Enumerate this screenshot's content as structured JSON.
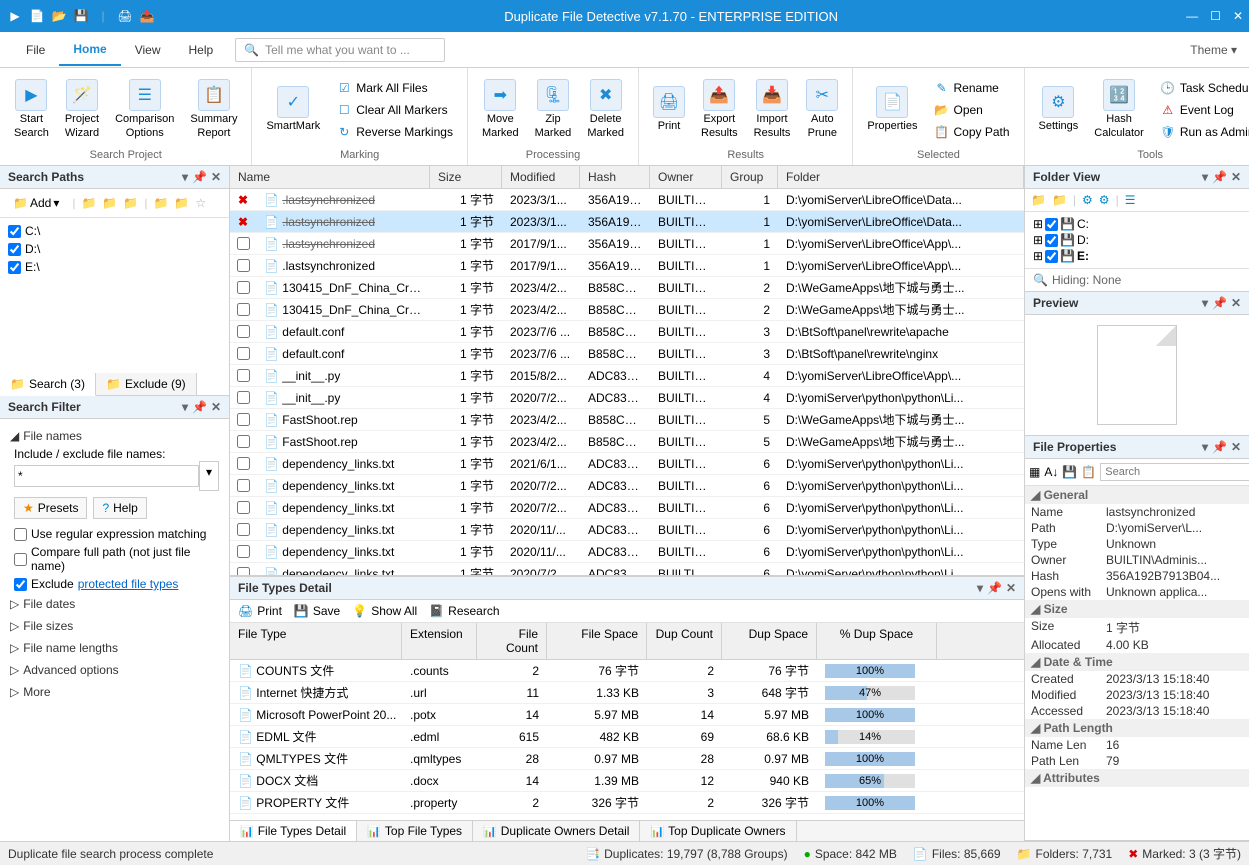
{
  "title": "Duplicate File Detective v7.1.70 - ENTERPRISE EDITION",
  "menu": {
    "file": "File",
    "home": "Home",
    "view": "View",
    "help": "Help",
    "search_placeholder": "Tell me what you want to ...",
    "theme": "Theme"
  },
  "ribbon": {
    "g1_label": "Search Project",
    "start_search": "Start\nSearch",
    "project_wizard": "Project\nWizard",
    "comparison_options": "Comparison\nOptions",
    "summary_report": "Summary\nReport",
    "g2_label": "Marking",
    "smartmark": "SmartMark",
    "mark_all": "Mark All Files",
    "clear_all": "Clear All Markers",
    "reverse": "Reverse Markings",
    "g3_label": "Processing",
    "move_marked": "Move\nMarked",
    "zip_marked": "Zip\nMarked",
    "delete_marked": "Delete\nMarked",
    "g4_label": "Results",
    "print": "Print",
    "export": "Export\nResults",
    "import": "Import\nResults",
    "auto_prune": "Auto\nPrune",
    "g5_label": "Selected",
    "properties": "Properties",
    "rename": "Rename",
    "open": "Open",
    "copy_path": "Copy Path",
    "g6_label": "Tools",
    "settings": "Settings",
    "hash_calc": "Hash\nCalculator",
    "task_sched": "Task Scheduler",
    "event_log": "Event Log",
    "run_admin": "Run as Admin"
  },
  "search_paths": {
    "title": "Search Paths",
    "add": "Add",
    "drives": [
      "C:\\",
      "D:\\",
      "E:\\"
    ]
  },
  "path_tabs": {
    "search": "Search (3)",
    "exclude": "Exclude (9)"
  },
  "filter": {
    "title": "Search Filter",
    "filenames": "File names",
    "include_label": "Include / exclude file names:",
    "include_value": "*",
    "presets": "Presets",
    "help": "Help",
    "regex": "Use regular expression matching",
    "fullpath": "Compare full path (not just file name)",
    "exclude": "Exclude ",
    "protected": "protected file types",
    "dates": "File dates",
    "sizes": "File sizes",
    "lengths": "File name lengths",
    "advanced": "Advanced options",
    "more": "More"
  },
  "grid_cols": {
    "name": "Name",
    "size": "Size",
    "modified": "Modified",
    "hash": "Hash",
    "owner": "Owner",
    "group": "Group",
    "folder": "Folder"
  },
  "rows": [
    {
      "chk": "x",
      "name": ".lastsynchronized",
      "strike": true,
      "size": "1 字节",
      "mod": "2023/3/1...",
      "hash": "356A192B...",
      "owner": "BUILTIN\\...",
      "grp": "1",
      "folder": "D:\\yomiServer\\LibreOffice\\Data..."
    },
    {
      "chk": "x",
      "name": ".lastsynchronized",
      "strike": true,
      "sel": true,
      "size": "1 字节",
      "mod": "2023/3/1...",
      "hash": "356A192B...",
      "owner": "BUILTIN\\...",
      "grp": "1",
      "folder": "D:\\yomiServer\\LibreOffice\\Data..."
    },
    {
      "chk": "",
      "name": ".lastsynchronized",
      "strike": true,
      "size": "1 字节",
      "mod": "2017/9/1...",
      "hash": "356A192B...",
      "owner": "BUILTIN\\...",
      "grp": "1",
      "folder": "D:\\yomiServer\\LibreOffice\\App\\..."
    },
    {
      "chk": "",
      "name": ".lastsynchronized",
      "size": "1 字节",
      "mod": "2017/9/1...",
      "hash": "356A192B...",
      "owner": "BUILTIN\\...",
      "grp": "1",
      "folder": "D:\\yomiServer\\LibreOffice\\App\\..."
    },
    {
      "chk": "",
      "name": "130415_DnF_China_Creator...",
      "size": "1 字节",
      "mod": "2023/4/2...",
      "hash": "B858CB2...",
      "owner": "BUILTIN\\...",
      "grp": "2",
      "folder": "D:\\WeGameApps\\地下城与勇士..."
    },
    {
      "chk": "",
      "name": "130415_DnF_China_Creator...",
      "size": "1 字节",
      "mod": "2023/4/2...",
      "hash": "B858CB2...",
      "owner": "BUILTIN\\...",
      "grp": "2",
      "folder": "D:\\WeGameApps\\地下城与勇士..."
    },
    {
      "chk": "",
      "name": "default.conf",
      "size": "1 字节",
      "mod": "2023/7/6 ...",
      "hash": "B858CB2...",
      "owner": "BUILTIN\\...",
      "grp": "3",
      "folder": "D:\\BtSoft\\panel\\rewrite\\apache"
    },
    {
      "chk": "",
      "name": "default.conf",
      "size": "1 字节",
      "mod": "2023/7/6 ...",
      "hash": "B858CB2...",
      "owner": "BUILTIN\\...",
      "grp": "3",
      "folder": "D:\\BtSoft\\panel\\rewrite\\nginx"
    },
    {
      "chk": "",
      "name": "__init__.py",
      "size": "1 字节",
      "mod": "2015/8/2...",
      "hash": "ADC83B1...",
      "owner": "BUILTIN\\...",
      "grp": "4",
      "folder": "D:\\yomiServer\\LibreOffice\\App\\..."
    },
    {
      "chk": "",
      "name": "__init__.py",
      "size": "1 字节",
      "mod": "2020/7/2...",
      "hash": "ADC83B1...",
      "owner": "BUILTIN\\...",
      "grp": "4",
      "folder": "D:\\yomiServer\\python\\python\\Li..."
    },
    {
      "chk": "",
      "name": "FastShoot.rep",
      "size": "1 字节",
      "mod": "2023/4/2...",
      "hash": "B858CB2...",
      "owner": "BUILTIN\\...",
      "grp": "5",
      "folder": "D:\\WeGameApps\\地下城与勇士..."
    },
    {
      "chk": "",
      "name": "FastShoot.rep",
      "size": "1 字节",
      "mod": "2023/4/2...",
      "hash": "B858CB2...",
      "owner": "BUILTIN\\...",
      "grp": "5",
      "folder": "D:\\WeGameApps\\地下城与勇士..."
    },
    {
      "chk": "",
      "name": "dependency_links.txt",
      "size": "1 字节",
      "mod": "2021/6/1...",
      "hash": "ADC83B1...",
      "owner": "BUILTIN\\...",
      "grp": "6",
      "folder": "D:\\yomiServer\\python\\python\\Li..."
    },
    {
      "chk": "",
      "name": "dependency_links.txt",
      "size": "1 字节",
      "mod": "2020/7/2...",
      "hash": "ADC83B1...",
      "owner": "BUILTIN\\...",
      "grp": "6",
      "folder": "D:\\yomiServer\\python\\python\\Li..."
    },
    {
      "chk": "",
      "name": "dependency_links.txt",
      "size": "1 字节",
      "mod": "2020/7/2...",
      "hash": "ADC83B1...",
      "owner": "BUILTIN\\...",
      "grp": "6",
      "folder": "D:\\yomiServer\\python\\python\\Li..."
    },
    {
      "chk": "",
      "name": "dependency_links.txt",
      "size": "1 字节",
      "mod": "2020/11/...",
      "hash": "ADC83B1...",
      "owner": "BUILTIN\\...",
      "grp": "6",
      "folder": "D:\\yomiServer\\python\\python\\Li..."
    },
    {
      "chk": "",
      "name": "dependency_links.txt",
      "size": "1 字节",
      "mod": "2020/11/...",
      "hash": "ADC83B1...",
      "owner": "BUILTIN\\...",
      "grp": "6",
      "folder": "D:\\yomiServer\\python\\python\\Li..."
    },
    {
      "chk": "",
      "name": "dependency_links.txt",
      "size": "1 字节",
      "mod": "2020/7/2...",
      "hash": "ADC83B1...",
      "owner": "BUILTIN\\...",
      "grp": "6",
      "folder": "D:\\yomiServer\\python\\python\\Li..."
    }
  ],
  "detail": {
    "title": "File Types Detail",
    "print": "Print",
    "save": "Save",
    "show_all": "Show All",
    "research": "Research",
    "cols": {
      "type": "File Type",
      "ext": "Extension",
      "count": "File Count",
      "space": "File Space",
      "dcount": "Dup Count",
      "dspace": "Dup Space",
      "pct": "% Dup Space"
    },
    "rows": [
      {
        "type": "COUNTS 文件",
        "ext": ".counts",
        "count": "2",
        "space": "76 字节",
        "dcount": "2",
        "dspace": "76 字节",
        "pct": 100
      },
      {
        "type": "Internet 快捷方式",
        "ext": ".url",
        "count": "11",
        "space": "1.33 KB",
        "dcount": "3",
        "dspace": "648 字节",
        "pct": 47
      },
      {
        "type": "Microsoft PowerPoint 20...",
        "ext": ".potx",
        "count": "14",
        "space": "5.97 MB",
        "dcount": "14",
        "dspace": "5.97 MB",
        "pct": 100
      },
      {
        "type": "EDML 文件",
        "ext": ".edml",
        "count": "615",
        "space": "482 KB",
        "dcount": "69",
        "dspace": "68.6 KB",
        "pct": 14
      },
      {
        "type": "QMLTYPES 文件",
        "ext": ".qmltypes",
        "count": "28",
        "space": "0.97 MB",
        "dcount": "28",
        "dspace": "0.97 MB",
        "pct": 100
      },
      {
        "type": "DOCX 文档",
        "ext": ".docx",
        "count": "14",
        "space": "1.39 MB",
        "dcount": "12",
        "dspace": "940 KB",
        "pct": 65
      },
      {
        "type": "PROPERTY 文件",
        "ext": ".property",
        "count": "2",
        "space": "326 字节",
        "dcount": "2",
        "dspace": "326 字节",
        "pct": 100
      }
    ],
    "tabs": {
      "t1": "File Types Detail",
      "t2": "Top File Types",
      "t3": "Duplicate Owners Detail",
      "t4": "Top Duplicate Owners"
    }
  },
  "folder_view": {
    "title": "Folder View",
    "drives": [
      "C:",
      "D:",
      "E:"
    ],
    "hiding": "Hiding: None"
  },
  "preview": {
    "title": "Preview"
  },
  "props": {
    "title": "File Properties",
    "search_ph": "Search",
    "general": "General",
    "name_k": "Name",
    "name_v": "lastsynchronized",
    "path_k": "Path",
    "path_v": "D:\\yomiServer\\L...",
    "type_k": "Type",
    "type_v": "Unknown",
    "owner_k": "Owner",
    "owner_v": "BUILTIN\\Adminis...",
    "hash_k": "Hash",
    "hash_v": "356A192B7913B04...",
    "opens_k": "Opens with",
    "opens_v": "Unknown applica...",
    "size": "Size",
    "size_k": "Size",
    "size_v": "1 字节",
    "alloc_k": "Allocated",
    "alloc_v": "4.00 KB",
    "date": "Date & Time",
    "created_k": "Created",
    "created_v": "2023/3/13 15:18:40",
    "modified_k": "Modified",
    "modified_v": "2023/3/13 15:18:40",
    "accessed_k": "Accessed",
    "accessed_v": "2023/3/13 15:18:40",
    "pathlen": "Path Length",
    "namelen_k": "Name Len",
    "namelen_v": "16",
    "pathlen_k": "Path Len",
    "pathlen_v": "79",
    "attr": "Attributes"
  },
  "status": {
    "msg": "Duplicate file search process complete",
    "dup": "Duplicates: 19,797 (8,788 Groups)",
    "space": "Space: 842 MB",
    "files": "Files: 85,669",
    "folders": "Folders: 7,731",
    "marked": "Marked: 3 (3 字节)"
  }
}
